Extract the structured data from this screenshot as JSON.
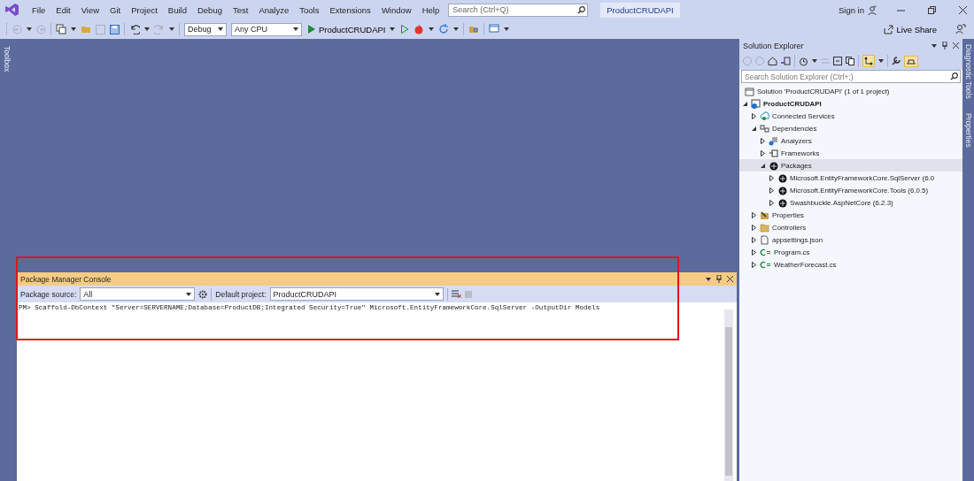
{
  "menu": {
    "items": [
      "File",
      "Edit",
      "View",
      "Git",
      "Project",
      "Build",
      "Debug",
      "Test",
      "Analyze",
      "Tools",
      "Extensions",
      "Window",
      "Help"
    ]
  },
  "search": {
    "placeholder": "Search (Ctrl+Q)"
  },
  "title_badge": "ProductCRUDAPI",
  "sign_in": "Sign in",
  "toolbar": {
    "configuration": "Debug",
    "platform": "Any CPU",
    "run_target": "ProductCRUDAPI",
    "live_share": "Live Share"
  },
  "side_tabs": {
    "left": [
      "Toolbox"
    ],
    "right": [
      "Diagnostic Tools",
      "Properties"
    ]
  },
  "solution_explorer": {
    "title": "Solution Explorer",
    "search": {
      "placeholder": "Search Solution Explorer (Ctrl+;)"
    },
    "solution": "Solution 'ProductCRUDAPI' (1 of 1 project)",
    "tree": [
      {
        "label": "ProductCRUDAPI",
        "kind": "project",
        "expanded": true,
        "selected": false,
        "children": [
          {
            "label": "Connected Services",
            "kind": "connected",
            "expanded": false,
            "selected": false
          },
          {
            "label": "Dependencies",
            "kind": "dependencies",
            "expanded": true,
            "selected": false,
            "children": [
              {
                "label": "Analyzers",
                "kind": "analyzers",
                "expanded": false,
                "selected": false
              },
              {
                "label": "Frameworks",
                "kind": "frameworks",
                "expanded": false,
                "selected": false
              },
              {
                "label": "Packages",
                "kind": "packages",
                "expanded": true,
                "selected": true,
                "children": [
                  {
                    "label": "Microsoft.EntityFrameworkCore.SqlServer (6.0",
                    "kind": "package",
                    "expanded": false,
                    "selected": false
                  },
                  {
                    "label": "Microsoft.EntityFrameworkCore.Tools (6.0.5)",
                    "kind": "package",
                    "expanded": false,
                    "selected": false
                  },
                  {
                    "label": "Swashbuckle.AspNetCore (6.2.3)",
                    "kind": "package",
                    "expanded": false,
                    "selected": false
                  }
                ]
              }
            ]
          },
          {
            "label": "Properties",
            "kind": "properties",
            "expanded": false,
            "selected": false
          },
          {
            "label": "Controllers",
            "kind": "folder",
            "expanded": false,
            "selected": false
          },
          {
            "label": "appsettings.json",
            "kind": "json",
            "expanded": false,
            "selected": false
          },
          {
            "label": "Program.cs",
            "kind": "csharp",
            "expanded": false,
            "selected": false
          },
          {
            "label": "WeatherForecast.cs",
            "kind": "csharp",
            "expanded": false,
            "selected": false
          }
        ]
      }
    ]
  },
  "console": {
    "title": "Package Manager Console",
    "package_source_label": "Package source:",
    "package_source": "All",
    "default_project_label": "Default project:",
    "default_project": "ProductCRUDAPI",
    "command_line": "PM> Scaffold-DbContext \"Server=SERVERNAME;Database=ProductDB;Integrated Security=True\" Microsoft.EntityFrameworkCore.SqlServer -OutputDir Models"
  }
}
